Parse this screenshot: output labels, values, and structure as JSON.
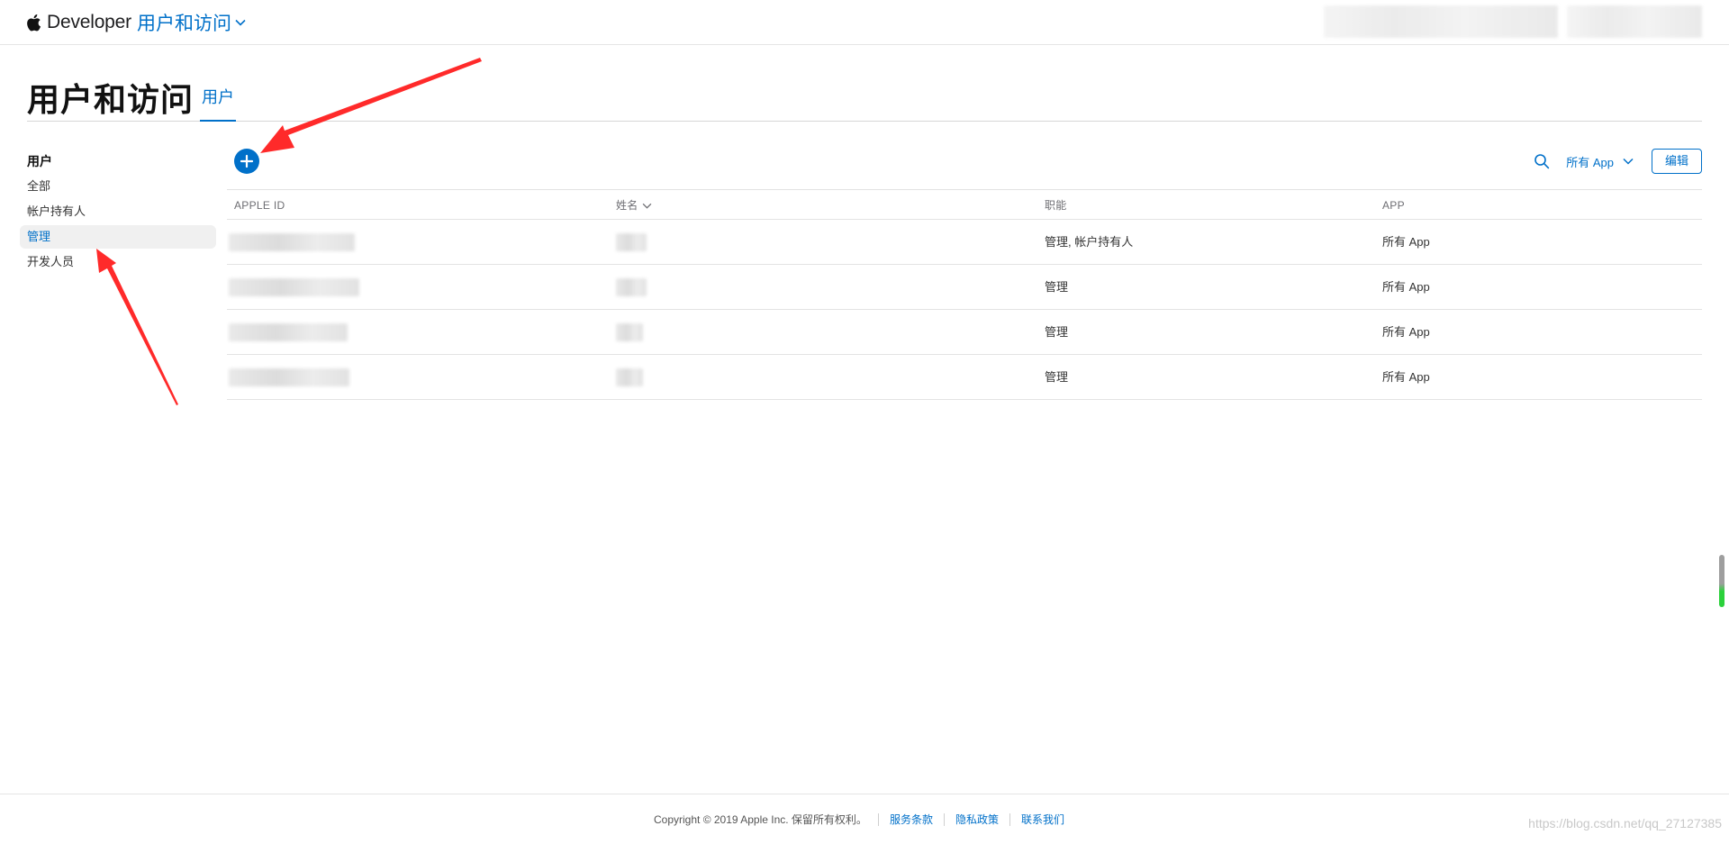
{
  "topbar": {
    "brand_name": "Developer",
    "section_title": "用户和访问"
  },
  "page": {
    "title": "用户和访问",
    "tab_label": "用户"
  },
  "sidebar": {
    "heading": "用户",
    "items": [
      {
        "label": "全部",
        "active": false
      },
      {
        "label": "帐户持有人",
        "active": false
      },
      {
        "label": "管理",
        "active": true
      },
      {
        "label": "开发人员",
        "active": false
      }
    ]
  },
  "toolbar": {
    "filter_label": "所有 App",
    "edit_label": "编辑"
  },
  "table": {
    "headers": {
      "apple_id": "APPLE ID",
      "name": "姓名",
      "role": "职能",
      "app": "APP"
    },
    "rows": [
      {
        "role": "管理, 帐户持有人",
        "app": "所有 App"
      },
      {
        "role": "管理",
        "app": "所有 App"
      },
      {
        "role": "管理",
        "app": "所有 App"
      },
      {
        "role": "管理",
        "app": "所有 App"
      }
    ]
  },
  "footer": {
    "copyright": "Copyright © 2019 Apple Inc. 保留所有权利。",
    "links": [
      "服务条款",
      "隐私政策",
      "联系我们"
    ],
    "watermark": "https://blog.csdn.net/qq_27127385"
  },
  "colors": {
    "accent": "#0070c9",
    "annotation_arrow": "#ff2a2a"
  }
}
